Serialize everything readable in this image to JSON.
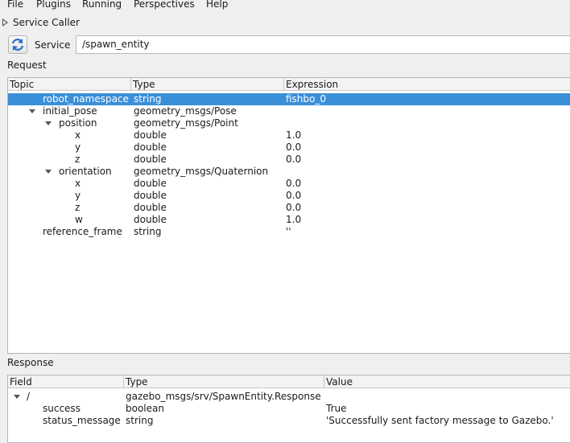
{
  "menu": {
    "file": "File",
    "plugins": "Plugins",
    "running": "Running",
    "perspectives": "Perspectives",
    "help": "Help"
  },
  "dock_title": "Service Caller",
  "service": {
    "label": "Service",
    "value": "/spawn_entity"
  },
  "request": {
    "label": "Request",
    "headers": {
      "topic": "Topic",
      "type": "Type",
      "expression": "Expression"
    },
    "rows": [
      {
        "topic": "robot_namespace",
        "type": "string",
        "expression": "fishbo_0"
      },
      {
        "topic": "initial_pose",
        "type": "geometry_msgs/Pose",
        "expression": ""
      },
      {
        "topic": "position",
        "type": "geometry_msgs/Point",
        "expression": ""
      },
      {
        "topic": "x",
        "type": "double",
        "expression": "1.0"
      },
      {
        "topic": "y",
        "type": "double",
        "expression": "0.0"
      },
      {
        "topic": "z",
        "type": "double",
        "expression": "0.0"
      },
      {
        "topic": "orientation",
        "type": "geometry_msgs/Quaternion",
        "expression": ""
      },
      {
        "topic": "x",
        "type": "double",
        "expression": "0.0"
      },
      {
        "topic": "y",
        "type": "double",
        "expression": "0.0"
      },
      {
        "topic": "z",
        "type": "double",
        "expression": "0.0"
      },
      {
        "topic": "w",
        "type": "double",
        "expression": "1.0"
      },
      {
        "topic": "reference_frame",
        "type": "string",
        "expression": "''"
      }
    ]
  },
  "response": {
    "label": "Response",
    "headers": {
      "field": "Field",
      "type": "Type",
      "value": "Value"
    },
    "rows": [
      {
        "field": "/",
        "type": "gazebo_msgs/srv/SpawnEntity.Response",
        "value": ""
      },
      {
        "field": "success",
        "type": "boolean",
        "value": "True"
      },
      {
        "field": "status_message",
        "type": "string",
        "value": "'Successfully sent factory message to Gazebo.'"
      }
    ]
  },
  "colors": {
    "selection": "#3a8fd9",
    "refresh_icon": "#2a6fc9"
  },
  "icons": {
    "refresh": "refresh-icon",
    "collapse": "triangle-right-icon",
    "expand": "chevron-down-icon"
  }
}
